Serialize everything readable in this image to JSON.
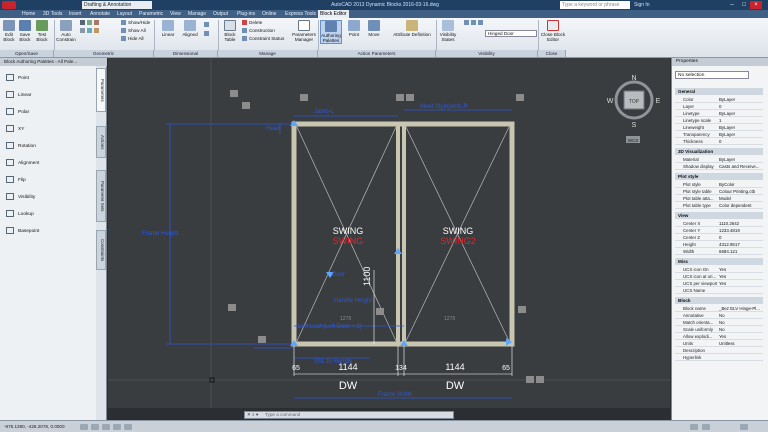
{
  "titlebar": {
    "workspace": "Drafting & Annotation",
    "app_name": "AutoCAD 2013",
    "document": "Dynamic Blocks 2016-03-16.dwg",
    "search_placeholder": "Type a keyword or phrase",
    "signin": "Sign In"
  },
  "menu_tabs": [
    "Home",
    "3D Tools",
    "Insert",
    "Annotate",
    "Layout",
    "Parametric",
    "View",
    "Manage",
    "Output",
    "Plug-ins",
    "Online",
    "Express Tools",
    "Block Editor"
  ],
  "active_tab": "Block Editor",
  "ribbon": {
    "open_save": {
      "title": "Open/Save",
      "buttons": [
        "Edit Block",
        "Save Block",
        "Test Block"
      ]
    },
    "geometric": {
      "title": "Geometric",
      "buttons": [
        "Auto Constrain"
      ],
      "small": [
        "Show/Hide",
        "Show All",
        "Hide All"
      ]
    },
    "dimensional": {
      "title": "Dimensional",
      "buttons": [
        "Linear",
        "Aligned"
      ]
    },
    "manage": {
      "title": "Manage",
      "buttons": [
        "Block Table"
      ],
      "small": [
        "Delete",
        "Construction",
        "Constraint Status"
      ]
    },
    "authoring": {
      "buttons": [
        "Parameters Manager",
        "Authoring Palettes"
      ]
    },
    "action_params": {
      "title": "Action Parameters",
      "buttons": [
        "Point",
        "Move",
        "Attribute Definition"
      ]
    },
    "visibility": {
      "title": "Visibility",
      "buttons": [
        "Visibility States"
      ],
      "state": "Hinged Door"
    },
    "close": {
      "title": "Close",
      "buttons": [
        "Close Block Editor"
      ]
    }
  },
  "left_palette": {
    "title": "Block Authoring Palettes - All Pale...",
    "tools": [
      "Point",
      "Linear",
      "Polar",
      "XY",
      "Rotation",
      "Alignment",
      "Flip",
      "Visibility",
      "Lookup",
      "Basepoint"
    ],
    "tabs": [
      "Parameters",
      "Actions",
      "Parameter Sets",
      "Constraints"
    ]
  },
  "drawing": {
    "param_labels": [
      "Jamb-L",
      "Meet Stylejamb-R",
      "Head",
      "Frame Height",
      "Door",
      "Handle Height",
      "Left Leaf (Left Door + 2)",
      "SSL to Handle",
      "Frame Width"
    ],
    "swing_labels": [
      "SWING",
      "SWING",
      "SWING",
      "SWING2"
    ],
    "dims": [
      "65",
      "1144",
      "134",
      "1144",
      "65"
    ],
    "dw_labels": [
      "DW",
      "DW"
    ],
    "vertical_dim": "1100",
    "small_dims": [
      "1278",
      "1278"
    ],
    "viewcube": {
      "top": "TOP",
      "n": "N",
      "s": "S",
      "e": "E",
      "w": "W",
      "wcs": "WCS"
    }
  },
  "command_line": {
    "placeholder": "Type a command"
  },
  "properties": {
    "title": "Properties",
    "selection": "No selection",
    "groups": [
      {
        "name": "General",
        "rows": [
          [
            "Color",
            "ByLayer"
          ],
          [
            "Layer",
            "0"
          ],
          [
            "Linetype",
            "ByLayer"
          ],
          [
            "Linetype scale",
            "1"
          ],
          [
            "Lineweight",
            "ByLayer"
          ],
          [
            "Transparency",
            "ByLayer"
          ],
          [
            "Thickness",
            "0"
          ]
        ]
      },
      {
        "name": "3D Visualization",
        "rows": [
          [
            "Material",
            "ByLayer"
          ],
          [
            "Shadow display",
            "Casts and Receive..."
          ]
        ]
      },
      {
        "name": "Plot style",
        "rows": [
          [
            "Plot style",
            "ByColor"
          ],
          [
            "Plot style table",
            "Colour Printing.ctb"
          ],
          [
            "Plot table atta...",
            "Model"
          ],
          [
            "Plot table type",
            "Color dependent"
          ]
        ]
      },
      {
        "name": "View",
        "rows": [
          [
            "Center X",
            "1110.2642"
          ],
          [
            "Center Y",
            "1233.4819"
          ],
          [
            "Center Z",
            "0"
          ],
          [
            "Height",
            "4312.9517"
          ],
          [
            "Width",
            "6684.121"
          ]
        ]
      },
      {
        "name": "Misc",
        "rows": [
          [
            "UCS icon On",
            "Yes"
          ],
          [
            "UCS icon at ori...",
            "Yes"
          ],
          [
            "UCS per viewport",
            "Yes"
          ],
          [
            "UCS Name",
            ""
          ]
        ]
      },
      {
        "name": "Block",
        "rows": [
          [
            "Block name",
            "_Bez ELV Hinge-Pl..."
          ],
          [
            "Annotative",
            "No"
          ],
          [
            "Match orienta...",
            "No"
          ],
          [
            "Scale uniformly",
            "No"
          ],
          [
            "Allow explodi...",
            "Yes"
          ],
          [
            "Units",
            "Unitless"
          ],
          [
            "Description",
            ""
          ],
          [
            "Hyperlink",
            ""
          ]
        ]
      }
    ]
  },
  "status": {
    "coords": "-975.1390, -426.2078, 0.0000"
  }
}
